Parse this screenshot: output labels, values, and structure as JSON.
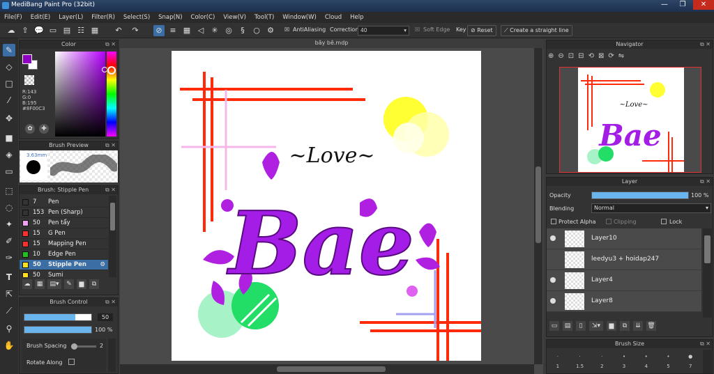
{
  "app": {
    "title": "MediBang Paint Pro (32bit)"
  },
  "menu": [
    "File(F)",
    "Edit(E)",
    "Layer(L)",
    "Filter(R)",
    "Select(S)",
    "Snap(N)",
    "Color(C)",
    "View(V)",
    "Tool(T)",
    "Window(W)",
    "Cloud",
    "Help"
  ],
  "toolbar": {
    "antialiasing_label": "AntiAliasing",
    "correction_label": "Correction",
    "correction_value": "40",
    "soft_edge_label": "Soft Edge",
    "key_label": "Key",
    "reset_label": "Reset",
    "straight_line_label": "Create a straight line"
  },
  "color_panel": {
    "title": "Color",
    "r_value": "R:143",
    "g_value": "G:0",
    "b_value": "B:195",
    "hex_value": "#8F00C3",
    "foreground_color": "#8F00C3",
    "background_color": "#FFFFFF"
  },
  "brush_preview": {
    "title": "Brush Preview",
    "size": "3.63mm"
  },
  "brush_list": {
    "title": "Brush: Stipple Pen",
    "items": [
      {
        "size": "7",
        "name": "Pen",
        "color": "#333333"
      },
      {
        "size": "153",
        "name": "Pen (Sharp)",
        "color": "#333333"
      },
      {
        "size": "50",
        "name": "Pen tẩy",
        "color": "#f0a0f0"
      },
      {
        "size": "15",
        "name": "G Pen",
        "color": "#ff3030"
      },
      {
        "size": "15",
        "name": "Mapping Pen",
        "color": "#ff3030"
      },
      {
        "size": "10",
        "name": "Edge Pen",
        "color": "#20c020"
      },
      {
        "size": "50",
        "name": "Stipple Pen",
        "color": "#ffe020"
      },
      {
        "size": "50",
        "name": "Sumi",
        "color": "#ffe020"
      }
    ],
    "selected_index": 6
  },
  "brush_control": {
    "title": "Brush Control",
    "size_value": "50",
    "opacity_value": "100 %",
    "spacing_label": "Brush Spacing",
    "spacing_value": "2",
    "rotate_label": "Rotate Along"
  },
  "canvas": {
    "tab_title": "bây bê.mdp",
    "love_text": "~Love~",
    "bae_text": "Bae"
  },
  "navigator": {
    "title": "Navigator"
  },
  "layer_panel": {
    "title": "Layer",
    "opacity_label": "Opacity",
    "opacity_value": "100 %",
    "blending_label": "Blending",
    "blending_value": "Normal",
    "protect_alpha_label": "Protect Alpha",
    "clipping_label": "Clipping",
    "lock_label": "Lock",
    "layers": [
      {
        "name": "Layer10",
        "visible": true
      },
      {
        "name": "leedyu3 + hoidap247",
        "visible": false
      },
      {
        "name": "Layer4",
        "visible": true
      },
      {
        "name": "Layer8",
        "visible": true
      }
    ]
  },
  "brush_size_panel": {
    "title": "Brush Size",
    "sizes": [
      "1",
      "1.5",
      "2",
      "3",
      "4",
      "5",
      "7"
    ]
  }
}
